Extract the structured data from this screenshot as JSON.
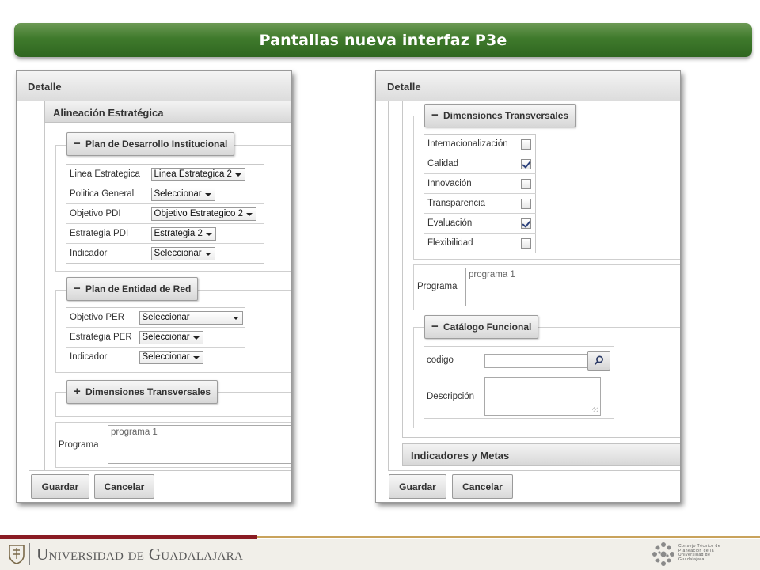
{
  "banner": {
    "title": "Pantallas nueva interfaz P3e"
  },
  "left": {
    "header": "Detalle",
    "section_title": "Alineación Estratégica",
    "pdi": {
      "legend": "Plan de Desarrollo Institucional",
      "rows": [
        {
          "label": "Linea Estrategica",
          "value": "Linea Estrategica 2"
        },
        {
          "label": "Politica General",
          "value": "Seleccionar"
        },
        {
          "label": "Objetivo PDI",
          "value": "Objetivo Estrategico 2"
        },
        {
          "label": "Estrategia PDI",
          "value": "Estrategia 2"
        },
        {
          "label": "Indicador",
          "value": "Seleccionar"
        }
      ]
    },
    "per": {
      "legend": "Plan de Entidad de Red",
      "rows": [
        {
          "label": "Objetivo PER",
          "value": "Seleccionar"
        },
        {
          "label": "Estrategia PER",
          "value": "Seleccionar"
        },
        {
          "label": "Indicador",
          "value": "Seleccionar"
        }
      ]
    },
    "dim_legend": "Dimensiones Transversales",
    "programa": {
      "label": "Programa",
      "value": "programa 1"
    },
    "buttons": {
      "save": "Guardar",
      "cancel": "Cancelar"
    }
  },
  "right": {
    "header": "Detalle",
    "dim": {
      "legend": "Dimensiones Transversales",
      "items": [
        {
          "label": "Internacionalización",
          "checked": false
        },
        {
          "label": "Calidad",
          "checked": true
        },
        {
          "label": "Innovación",
          "checked": false
        },
        {
          "label": "Transparencia",
          "checked": false
        },
        {
          "label": "Evaluación",
          "checked": true
        },
        {
          "label": "Flexibilidad",
          "checked": false
        }
      ]
    },
    "programa": {
      "label": "Programa",
      "value": "programa 1"
    },
    "catalogo": {
      "legend": "Catálogo Funcional",
      "codigo_label": "codigo",
      "codigo_value": "",
      "descripcion_label": "Descripción",
      "descripcion_value": ""
    },
    "indicadores_title": "Indicadores y Metas",
    "buttons": {
      "save": "Guardar",
      "cancel": "Cancelar"
    }
  },
  "footer": {
    "university": "Universidad de Guadalajara",
    "council": "Consejo Técnico de Planeación de la Universidad de Guadalajara"
  },
  "colors": {
    "banner_green": "#3f7a2c",
    "footer_red": "#8a1c23",
    "footer_gold": "#c9a35c"
  }
}
